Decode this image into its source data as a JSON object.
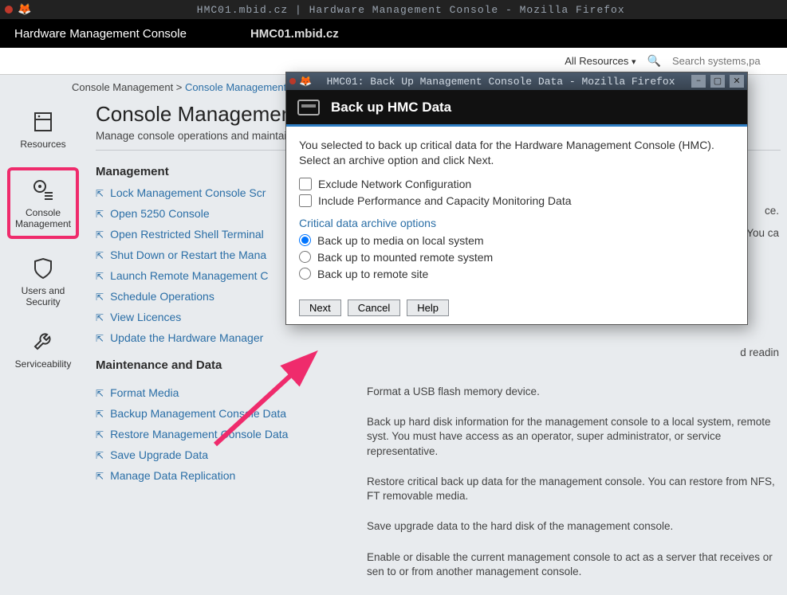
{
  "os_title": "HMC01.mbid.cz | Hardware Management Console - Mozilla Firefox",
  "app": {
    "brand": "Hardware Management Console",
    "host": "HMC01.mbid.cz"
  },
  "toolbar": {
    "all_resources": "All Resources",
    "search_placeholder": "Search systems,pa"
  },
  "breadcrumb": {
    "root": "Console Management >",
    "current": "Console Management"
  },
  "sidebar": {
    "resources": "Resources",
    "console": "Console Management",
    "users": "Users and Security",
    "service": "Serviceability"
  },
  "page": {
    "title": "Console Management",
    "subtitle": "Manage console operations and maintain"
  },
  "sections": {
    "management": "Management",
    "maintenance": "Maintenance and Data"
  },
  "mgmt_links": [
    "Lock Management Console Scr",
    "Open 5250 Console",
    "Open Restricted Shell Terminal",
    "Shut Down or Restart the Mana",
    "Launch Remote Management C",
    "Schedule Operations",
    "View Licences",
    "Update the Hardware Manager"
  ],
  "maint_links": [
    "Format Media",
    "Backup Management Console Data",
    "Restore Management Console Data",
    "Save Upgrade Data",
    "Manage Data Replication"
  ],
  "maint_desc": [
    "Format a USB flash memory device.",
    "Back up hard disk information for the management console to a local system, remote syst. You must have access as an operator, super administrator, or service representative.",
    "Restore critical back up data for the management console. You can restore from NFS, FT removable media.",
    "Save upgrade data to the hard disk of the management console.",
    "Enable or disable the current management console to act as a server that receives or sen to or from another management console."
  ],
  "frag": {
    "ce": "ce.",
    "youca": "y. You ca",
    "dreadin": "d readin"
  },
  "popup": {
    "window_title": "HMC01: Back Up Management Console Data - Mozilla Firefox",
    "header": "Back up HMC Data",
    "intro": "You selected to back up critical data for the Hardware Management Console (HMC). Select an archive option and click Next.",
    "chk_exclude": "Exclude Network Configuration",
    "chk_perf": "Include Performance and Capacity Monitoring Data",
    "group": "Critical data archive options",
    "radio": [
      "Back up to media on local system",
      "Back up to mounted remote system",
      "Back up to remote site"
    ],
    "btn_next": "Next",
    "btn_cancel": "Cancel",
    "btn_help": "Help"
  }
}
